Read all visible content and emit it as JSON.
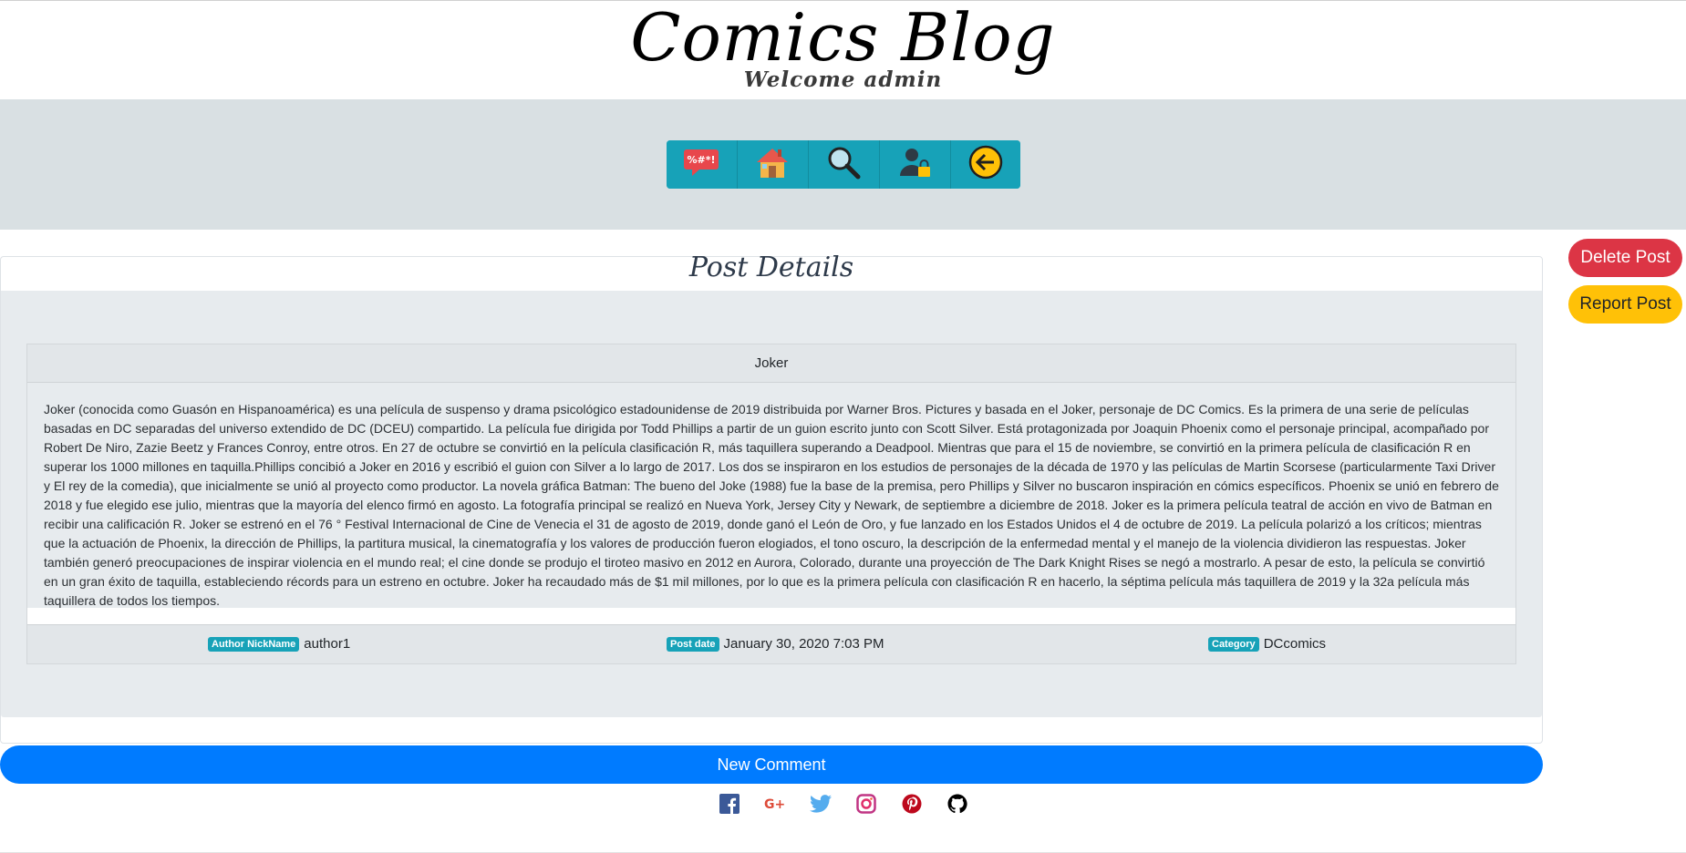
{
  "header": {
    "brand": "Comics Blog",
    "welcome": "Welcome admin"
  },
  "nav": {
    "items": [
      {
        "icon": "swearing-speech-bubble-icon"
      },
      {
        "icon": "house-icon"
      },
      {
        "icon": "magnifier-icon"
      },
      {
        "icon": "user-lock-icon"
      },
      {
        "icon": "logout-arrow-icon"
      }
    ]
  },
  "actions": {
    "delete_label": "Delete Post",
    "report_label": "Report Post"
  },
  "card": {
    "title": "Post Details"
  },
  "post": {
    "title": "Joker",
    "body": "Joker (conocida como Guasón en Hispanoamérica) es una película de suspenso y drama psicológico estadounidense de 2019 distribuida por Warner Bros. Pictures y basada en el Joker, personaje de DC Comics. Es la primera de una serie de películas basadas en DC separadas del universo extendido de DC (DCEU) compartido. La película fue dirigida por Todd Phillips a partir de un guion escrito junto con Scott Silver. Está protagonizada por Joaquin Phoenix como el personaje principal, acompañado por Robert De Niro, Zazie Beetz y Frances Conroy, entre otros. En 27 de octubre se convirtió en la película clasificación R, más taquillera superando a Deadpool. Mientras que para el 15 de noviembre, se convirtió en la primera película de clasificación R en superar los 1000 millones en taquilla.Phillips concibió a Joker en 2016 y escribió el guion con Silver a lo largo de 2017. Los dos se inspiraron en los estudios de personajes de la década de 1970 y las películas de Martin Scorsese (particularmente Taxi Driver y El rey de la comedia), que inicialmente se unió al proyecto como productor. La novela gráfica Batman: The bueno del Joke (1988) fue la base de la premisa, pero Phillips y Silver no buscaron inspiración en cómics específicos. Phoenix se unió en febrero de 2018 y fue elegido ese julio, mientras que la mayoría del elenco firmó en agosto. La fotografía principal se realizó en Nueva York, Jersey City y Newark, de septiembre a diciembre de 2018. Joker es la primera película teatral de acción en vivo de Batman en recibir una calificación R. Joker se estrenó en el 76 ° Festival Internacional de Cine de Venecia el 31 de agosto de 2019, donde ganó el León de Oro, y fue lanzado en los Estados Unidos el 4 de octubre de 2019. La película polarizó a los críticos; mientras que la actuación de Phoenix, la dirección de Phillips, la partitura musical, la cinematografía y los valores de producción fueron elogiados, el tono oscuro, la descripción de la enfermedad mental y el manejo de la violencia dividieron las respuestas. Joker también generó preocupaciones de inspirar violencia en el mundo real; el cine donde se produjo el tiroteo masivo en 2012 en Aurora, Colorado, durante una proyección de The Dark Knight Rises se negó a mostrarlo. A pesar de esto, la película se convirtió en un gran éxito de taquilla, estableciendo récords para un estreno en octubre. Joker ha recaudado más de $1 mil millones, por lo que es la primera película con clasificación R en hacerlo, la séptima película más taquillera de 2019 y la 32a película más taquillera de todos los tiempos.",
    "author_badge": "Author NickName",
    "author": "author1",
    "date_badge": "Post date",
    "date": "January 30, 2020 7:03 PM",
    "category_badge": "Category",
    "category": "DCcomics"
  },
  "comment": {
    "new_label": "New Comment"
  },
  "social": [
    {
      "icon": "facebook-icon",
      "color": "#3b5998"
    },
    {
      "icon": "google-plus-icon",
      "color": "#dd4b39"
    },
    {
      "icon": "twitter-icon",
      "color": "#55acee"
    },
    {
      "icon": "instagram-icon",
      "color": "#c13584"
    },
    {
      "icon": "pinterest-icon",
      "color": "#bd081c"
    },
    {
      "icon": "github-icon",
      "color": "#000000"
    }
  ]
}
